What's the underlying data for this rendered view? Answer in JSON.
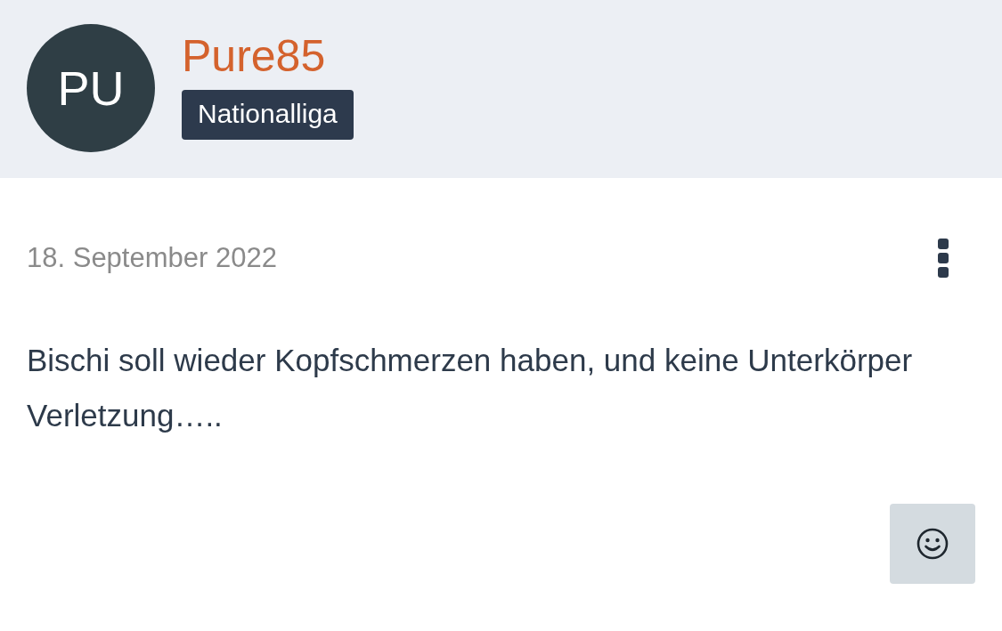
{
  "author": {
    "initials": "PU",
    "name": "Pure85",
    "rank": "Nationalliga"
  },
  "post": {
    "date": "18. September 2022",
    "text": "Bischi soll wieder Kopfschmerzen haben, und keine Unterkörper Verletzung….."
  }
}
